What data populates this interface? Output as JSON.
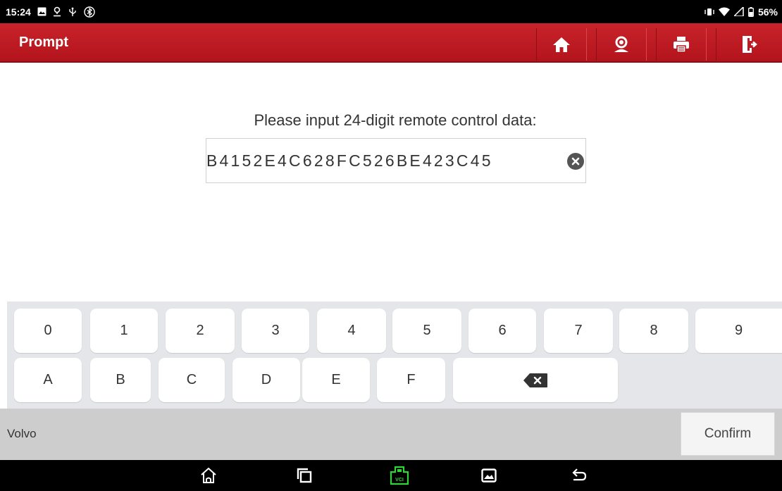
{
  "status_bar": {
    "time": "15:24",
    "battery": "56%",
    "icons": [
      "image-icon",
      "location-icon",
      "usb-icon",
      "bluetooth-icon",
      "vibrate-icon",
      "wifi-icon",
      "signal-icon",
      "battery-icon"
    ]
  },
  "header": {
    "title": "Prompt",
    "buttons": [
      "home-icon",
      "support-icon",
      "print-icon",
      "exit-icon"
    ]
  },
  "prompt": {
    "label": "Please input 24-digit remote control data:",
    "value": "B4152E4C628FC526BE423C45"
  },
  "keyboard": {
    "row1": [
      "0",
      "1",
      "2",
      "3",
      "4",
      "5",
      "6",
      "7",
      "8",
      "9"
    ],
    "row2": [
      "A",
      "B",
      "C",
      "D",
      "E",
      "F"
    ],
    "backspace_icon": "backspace-icon"
  },
  "footer": {
    "brand": "Volvo",
    "confirm_label": "Confirm"
  },
  "nav_bar": {
    "icons": [
      "home-icon",
      "recents-icon",
      "vci-icon",
      "gallery-icon",
      "back-icon"
    ],
    "vci_label": "VCI",
    "vci_color": "#2fd33a"
  },
  "colors": {
    "accent": "#c01c24",
    "status_bar": "#000000",
    "keyboard_bg": "#e4e6e9",
    "footer_bg": "#cdcdcd"
  }
}
